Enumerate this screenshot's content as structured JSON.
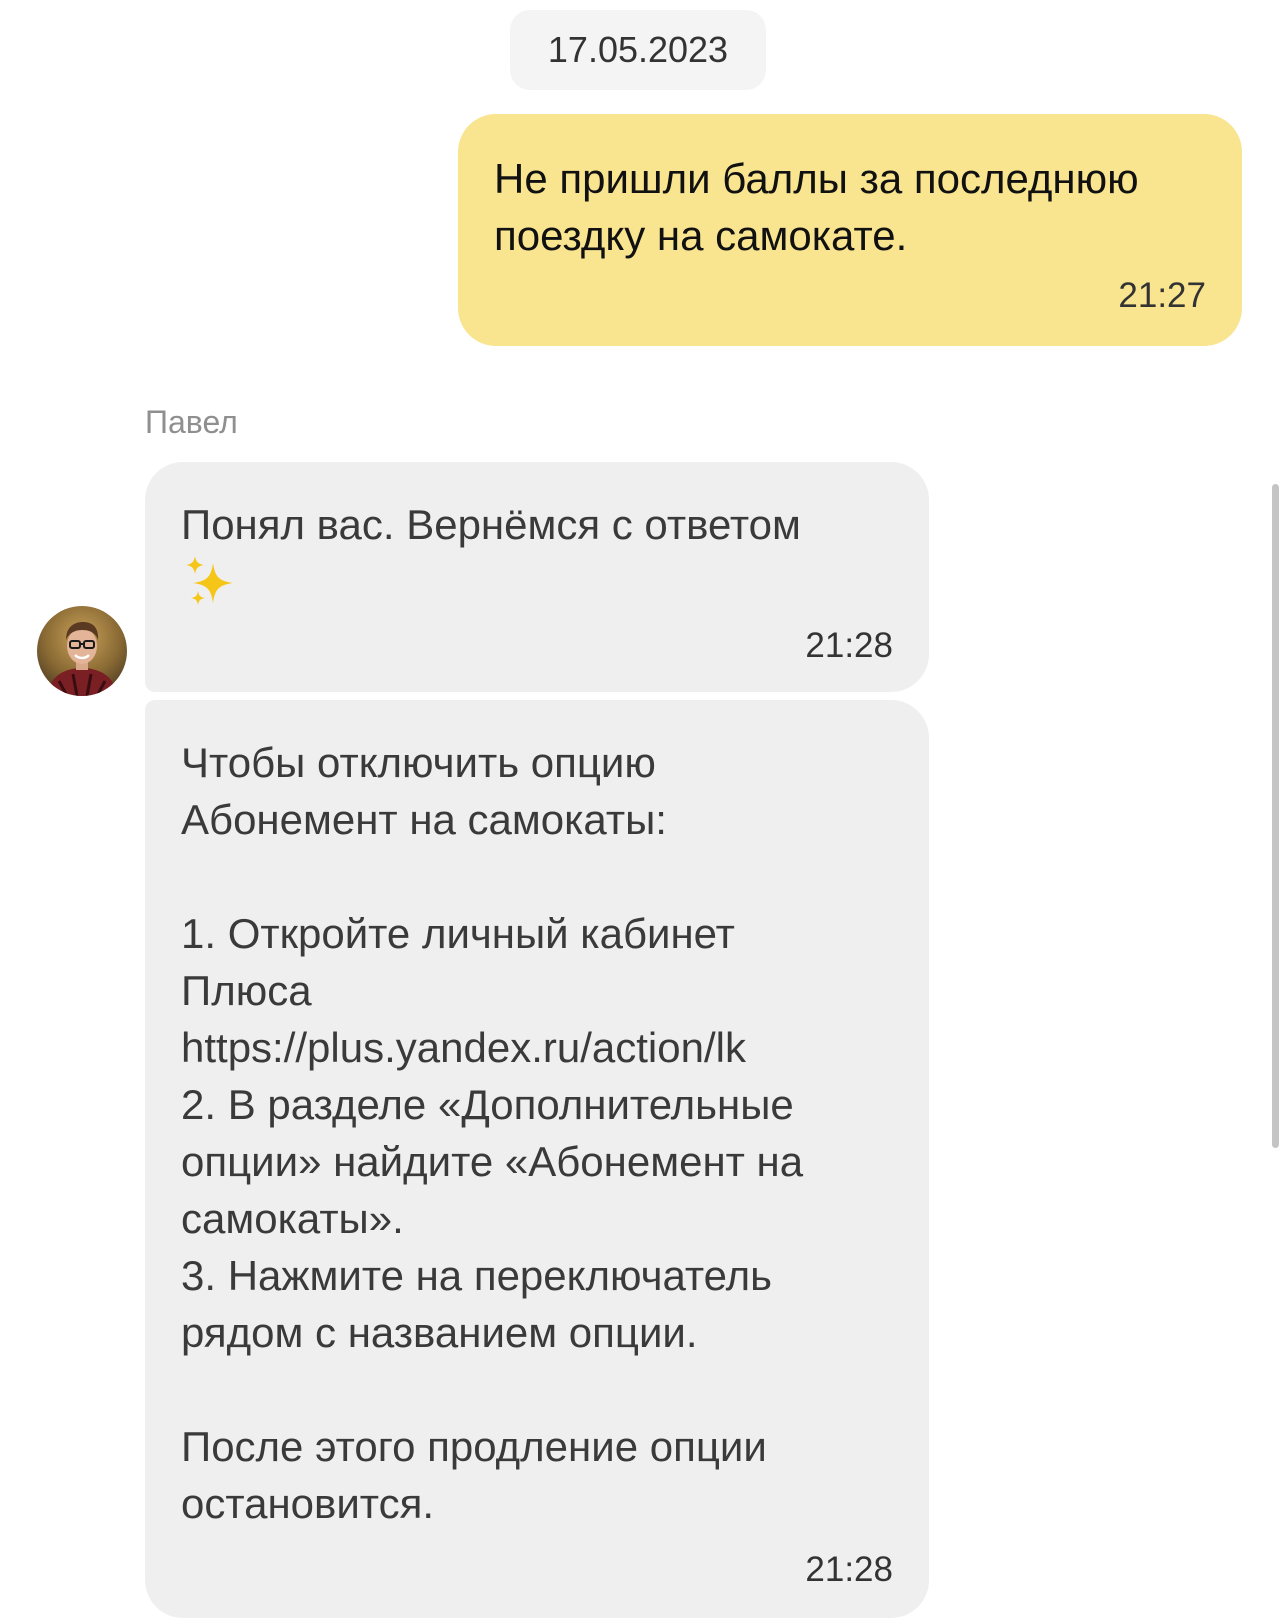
{
  "date_separator": "17.05.2023",
  "messages": [
    {
      "direction": "outgoing",
      "text": "Не пришли баллы за последнюю\nпоездку на самокате.",
      "time": "21:27"
    },
    {
      "direction": "incoming",
      "sender": "Павел",
      "text": "Понял вас. Вернёмся с ответом",
      "emoji": "sparkles-icon",
      "time": "21:28"
    },
    {
      "direction": "incoming",
      "sender": "Павел",
      "text": "Чтобы отключить опцию\nАбонемент на самокаты:\n\n1. Откройте личный кабинет\nПлюса\nhttps://plus.yandex.ru/action/lk\n2. В разделе «Дополнительные\nопции» найдите «Абонемент на\nсамокаты».\n3. Нажмите на переключатель\nрядом с названием опции.\n\nПосле этого продление опции\nостановится.",
      "time": "21:28"
    }
  ],
  "colors": {
    "outgoing_bubble": "#f9e48f",
    "incoming_bubble": "#efefef",
    "date_chip": "#f4f4f4",
    "sender_name": "#8f8f8f",
    "sparkles": "#f5c518"
  }
}
